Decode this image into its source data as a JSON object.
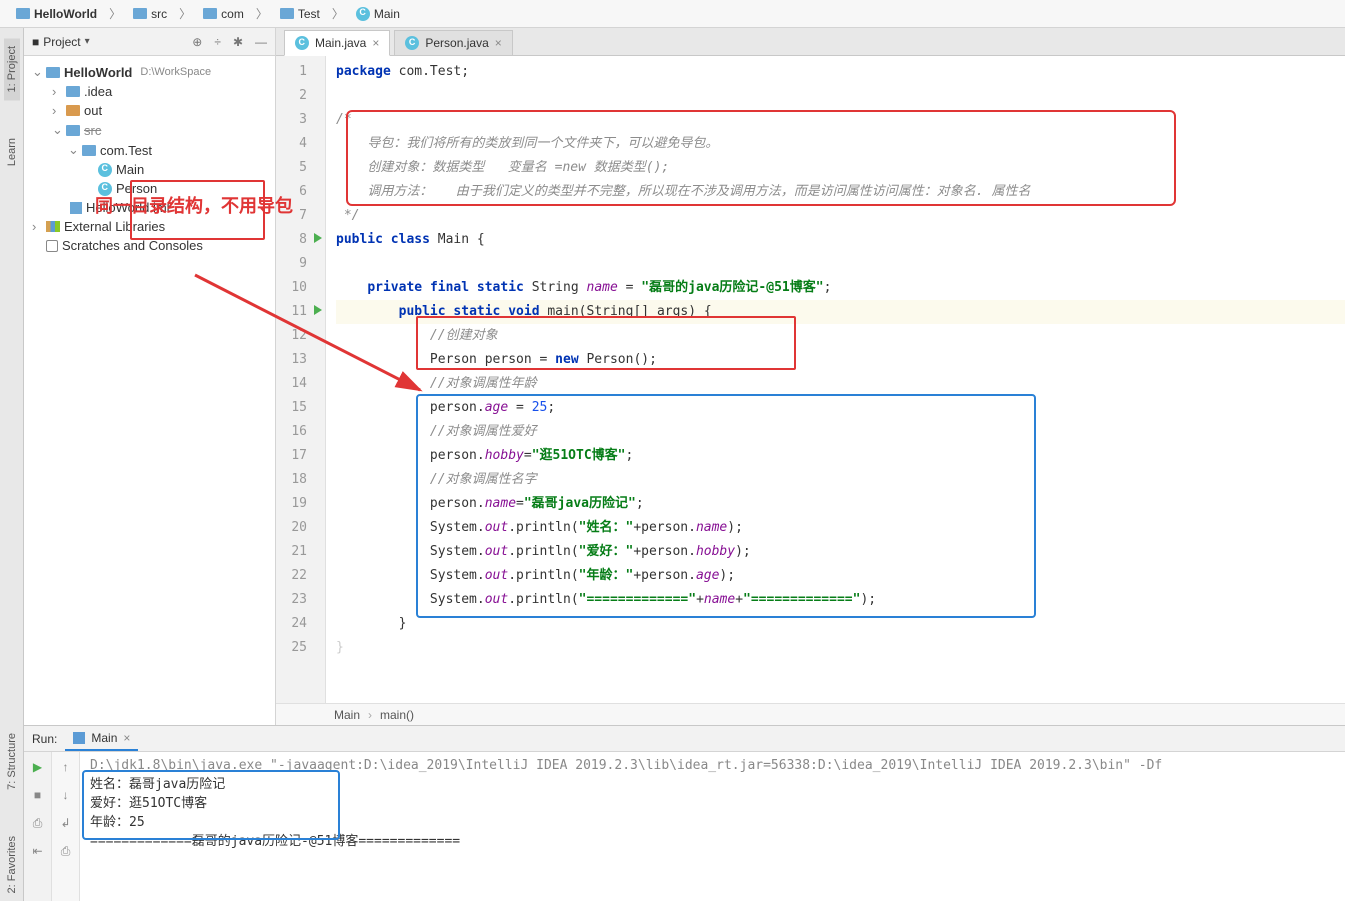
{
  "breadcrumb": [
    "HelloWorld",
    "src",
    "com",
    "Test",
    "Main"
  ],
  "left_sidebar_tabs": [
    "1: Project",
    "Learn",
    "7: Structure",
    "2: Favorites"
  ],
  "project_panel": {
    "title": "Project",
    "tree": {
      "root_name": "HelloWorld",
      "root_path": "D:\\WorkSpace",
      "idea": ".idea",
      "out": "out",
      "src": "src",
      "pkg": "com.Test",
      "main": "Main",
      "person": "Person",
      "iml": "HelloWorld.iml",
      "ext_libs": "External Libraries",
      "scratches": "Scratches and Consoles"
    }
  },
  "annotation_red_text": "同一目录结构，不用导包",
  "editor": {
    "tabs": [
      {
        "label": "Main.java",
        "active": true
      },
      {
        "label": "Person.java",
        "active": false
      }
    ],
    "lines": [
      "1",
      "2",
      "3",
      "4",
      "5",
      "6",
      "7",
      "8",
      "9",
      "10",
      "11",
      "12",
      "13",
      "14",
      "15",
      "16",
      "17",
      "18",
      "19",
      "20",
      "21",
      "22",
      "23",
      "24",
      "25"
    ],
    "breadcrumb_class": "Main",
    "breadcrumb_method": "main()",
    "comment_block": {
      "l1": "导包：我们将所有的类放到同一个文件夹下，可以避免导包。",
      "l2": "创建对象：数据类型   变量名 =new 数据类型();",
      "l3": "调用方法：   由于我们定义的类型并不完整，所以现在不涉及调用方法，而是访问属性访问属性：对象名. 属性名"
    },
    "code_text": {
      "package": "package",
      "pkg_name": "com.Test",
      "public": "public",
      "class": "class",
      "main_class": "Main",
      "private": "private",
      "final": "final",
      "static": "static",
      "string_t": "String",
      "name_var": "name",
      "name_val": "\"磊哥的java历险记-@51博客\"",
      "void": "void",
      "main_m": "main",
      "args": "(String[] args)",
      "c_create": "//创建对象",
      "person_t": "Person",
      "new": "new",
      "c_age": "//对象调属性年龄",
      "age_prop": "age",
      "age_val": "25",
      "c_hobby": "//对象调属性爱好",
      "hobby_prop": "hobby",
      "hobby_val": "\"逛51OTC博客\"",
      "c_name": "//对象调属性名字",
      "name_prop": "name",
      "pname_val": "\"磊哥java历险记\"",
      "sys": "System",
      "out": "out",
      "println": "println",
      "s_name": "\"姓名：\"",
      "s_hobby": "\"爱好：\"",
      "s_age": "\"年龄：\"",
      "s_eq1": "\"=============\"",
      "s_eq2": "\"=============\""
    }
  },
  "run": {
    "label": "Run:",
    "tab_name": "Main",
    "cmd_line": "D:\\jdk1.8\\bin\\java.exe \"-javaagent:D:\\idea_2019\\IntelliJ IDEA 2019.2.3\\lib\\idea_rt.jar=56338:D:\\idea_2019\\IntelliJ IDEA 2019.2.3\\bin\" -Df",
    "out_name": "姓名：磊哥java历险记",
    "out_hobby": "爱好：逛51OTC博客",
    "out_age": "年龄：25",
    "out_sep": "=============磊哥的java历险记-@51博客============="
  }
}
